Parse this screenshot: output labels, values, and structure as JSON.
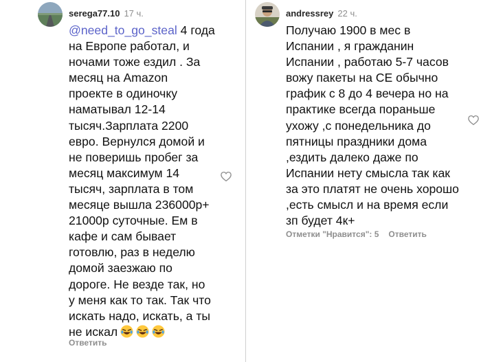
{
  "comments": [
    {
      "username": "serega77.10",
      "time": "17 ч.",
      "mention": "@need_to_go_steal",
      "first_line_rest": " 4 года",
      "lines": [
        "на Европе работал, и",
        "ночами тоже ездил . За",
        "месяц на Amazon",
        "проекте в одиночку",
        "наматывал 12-14",
        "тысяч.Зарплата 2200",
        "евро. Вернулся домой и",
        "не поверишь пробег за",
        "месяц максимум 14",
        "тысяч, зарплата в том",
        "месяце вышла 236000р+",
        "21000р суточные. Ем в",
        "кафе и сам бывает",
        "готовлю, раз в неделю",
        "домой заезжаю по",
        "дороге. Не везде так, но",
        "у меня как то так. Так что",
        "искать надо, искать, а ты"
      ],
      "last_line": "не искал",
      "emojis": [
        "laughing-face",
        "laughing-face",
        "laughing-face"
      ],
      "reply_label": "Ответить",
      "like_icon": "heart-outline"
    },
    {
      "username": "andressrey",
      "time": "22 ч.",
      "lines": [
        "Получаю 1900 в мес в",
        "Испании , я гражданин",
        "Испании , работаю 5-7 часов",
        "вожу пакеты на СЕ обычно",
        "график с 8 до 4 вечера но на",
        "практике всегда пораньше",
        "ухожу ,с понедельника до",
        "пятницы праздники дома",
        ",ездить далеко даже по",
        "Испании нету смысла так как",
        "за это платят не очень хорошо",
        ",есть смысл и на время если",
        "зп будет 4к+"
      ],
      "likes_label": "Отметки \"Нравится\": 5",
      "reply_label": "Ответить",
      "like_icon": "heart-outline"
    }
  ],
  "colors": {
    "mention": "#5b63c9",
    "meta": "#8e8e8e",
    "divider": "#cfcfcf"
  }
}
